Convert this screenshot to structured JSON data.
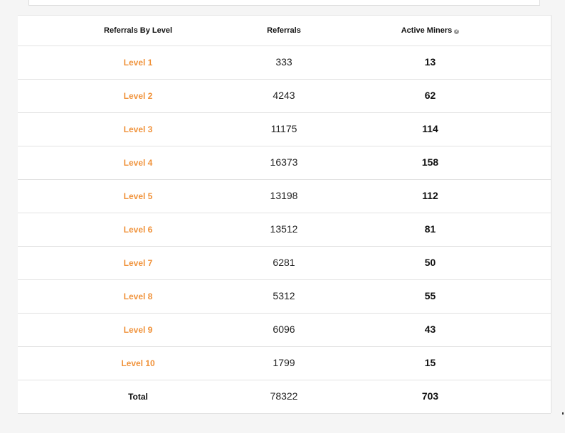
{
  "table": {
    "headers": {
      "level": "Referrals By Level",
      "referrals": "Referrals",
      "active": "Active Miners",
      "help_icon": "?"
    },
    "rows": [
      {
        "level": "Level 1",
        "referrals": "333",
        "active": "13"
      },
      {
        "level": "Level 2",
        "referrals": "4243",
        "active": "62"
      },
      {
        "level": "Level 3",
        "referrals": "11175",
        "active": "114"
      },
      {
        "level": "Level 4",
        "referrals": "16373",
        "active": "158"
      },
      {
        "level": "Level 5",
        "referrals": "13198",
        "active": "112"
      },
      {
        "level": "Level 6",
        "referrals": "13512",
        "active": "81"
      },
      {
        "level": "Level 7",
        "referrals": "6281",
        "active": "50"
      },
      {
        "level": "Level 8",
        "referrals": "5312",
        "active": "55"
      },
      {
        "level": "Level 9",
        "referrals": "6096",
        "active": "43"
      },
      {
        "level": "Level 10",
        "referrals": "1799",
        "active": "15"
      }
    ],
    "total": {
      "label": "Total",
      "referrals": "78322",
      "active": "703"
    }
  },
  "colors": {
    "level_link": "#f0923a",
    "border": "#e2e2e2",
    "background": "#f5f5f5"
  },
  "icons": {
    "help": "question-circle-icon"
  }
}
